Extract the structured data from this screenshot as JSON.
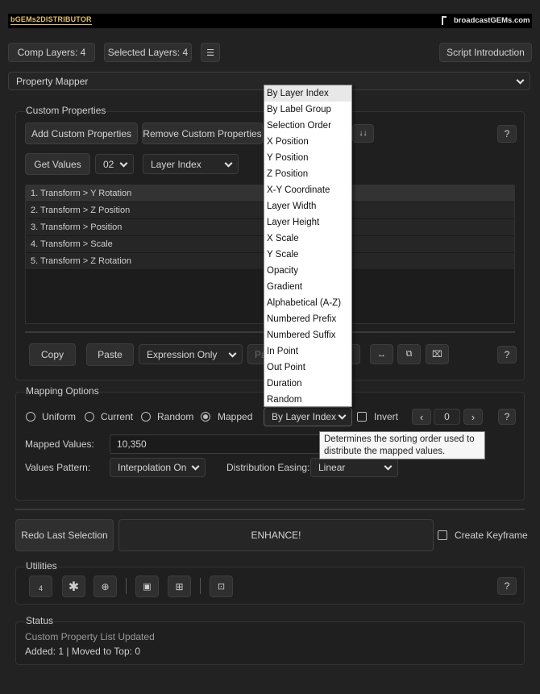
{
  "header": {
    "brand": "bGEMs2DISTRIBUTOR",
    "company": "broadcastGEMs.com"
  },
  "top_bar": {
    "comp_layers": "Comp Layers: 4",
    "selected_layers": "Selected Layers: 4",
    "script_intro": "Script Introduction"
  },
  "mode_select": {
    "value": "Property Mapper"
  },
  "custom_properties": {
    "title": "Custom Properties",
    "add_label": "Add Custom Properties",
    "remove_label": "Remove Custom Properties",
    "sort_icon": "↓↓",
    "help": "?",
    "get_values": "Get Values",
    "count_select": "02",
    "source_select": "Layer Index",
    "list": [
      "1. Transform > Y Rotation",
      "2. Transform > Z Position",
      "3. Transform > Position",
      "4. Transform > Scale",
      "5. Transform > Z Rotation"
    ],
    "copy": "Copy",
    "paste": "Paste",
    "expression_select": "Expression Only",
    "pa_partial": "Pa",
    "help2": "?"
  },
  "dropdown": {
    "items": [
      "By Layer Index",
      "By Label Group",
      "Selection Order",
      "X Position",
      "Y Position",
      "Z Position",
      "X-Y Coordinate",
      "Layer Width",
      "Layer Height",
      "X Scale",
      "Y Scale",
      "Opacity",
      "Gradient",
      "Alphabetical (A-Z)",
      "Numbered Prefix",
      "Numbered Suffix",
      "In Point",
      "Out Point",
      "Duration",
      "Random"
    ]
  },
  "mapping": {
    "title": "Mapping Options",
    "radios": [
      "Uniform",
      "Current",
      "Random",
      "Mapped"
    ],
    "selected_radio": "Mapped",
    "sort_select": "By Layer Index",
    "invert": "Invert",
    "offset_value": "0",
    "help": "?",
    "mapped_values_label": "Mapped Values:",
    "mapped_values": "10,350",
    "pattern_label": "Values Pattern:",
    "pattern_value": "Interpolation On",
    "easing_label": "Distribution Easing:",
    "easing_value": "Linear",
    "tooltip": "Determines the sorting order used to distribute the mapped values."
  },
  "actions": {
    "redo": "Redo Last Selection",
    "enhance": "ENHANCE!",
    "create_keyframe": "Create Keyframe"
  },
  "utilities": {
    "title": "Utilities",
    "help": "?"
  },
  "status": {
    "title": "Status",
    "line1": "Custom Property List Updated",
    "line2": "Added: 1 | Moved to Top: 0"
  }
}
